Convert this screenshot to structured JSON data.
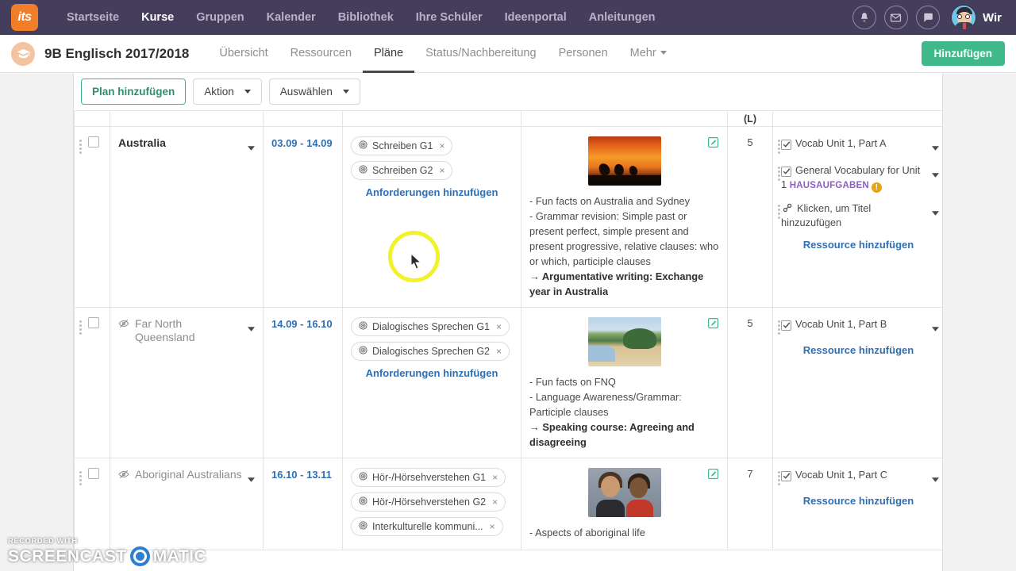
{
  "topnav": {
    "logo_text": "its",
    "links": [
      {
        "label": "Startseite",
        "active": false
      },
      {
        "label": "Kurse",
        "active": true
      },
      {
        "label": "Gruppen",
        "active": false
      },
      {
        "label": "Kalender",
        "active": false
      },
      {
        "label": "Bibliothek",
        "active": false
      },
      {
        "label": "Ihre Schüler",
        "active": false
      },
      {
        "label": "Ideenportal",
        "active": false
      },
      {
        "label": "Anleitungen",
        "active": false
      }
    ],
    "icons": [
      "bell-icon",
      "mail-icon",
      "chat-icon"
    ],
    "user_name": "Wir"
  },
  "coursebar": {
    "title": "9B Englisch 2017/2018",
    "tabs": [
      {
        "label": "Übersicht",
        "active": false
      },
      {
        "label": "Ressourcen",
        "active": false
      },
      {
        "label": "Pläne",
        "active": true
      },
      {
        "label": "Status/Nachbereitung",
        "active": false
      },
      {
        "label": "Personen",
        "active": false
      },
      {
        "label": "Mehr",
        "active": false,
        "has_caret": true
      }
    ],
    "add_button": "Hinzufügen"
  },
  "toolbar": {
    "add_plan_label": "Plan hinzufügen",
    "action_label": "Aktion",
    "select_label": "Auswählen"
  },
  "table": {
    "headers": {
      "lessons": "(L)"
    },
    "add_requirement_label": "Anforderungen hinzufügen",
    "add_resource_label": "Ressource hinzufügen",
    "rows": [
      {
        "title": "Australia",
        "hidden": false,
        "date": "03.09 - 14.09",
        "requirements": [
          {
            "label": "Schreiben G1"
          },
          {
            "label": "Schreiben G2"
          }
        ],
        "thumb": "kangaroo-sunset",
        "description_lines": [
          "- Fun facts on Australia and Sydney",
          "- Grammar revision: Simple past or present perfect, simple present and present progressive, relative clauses: who or which, participle clauses"
        ],
        "description_bold": "→ Argumentative writing: Exchange year in Australia",
        "lessons": "5",
        "resources": [
          {
            "label": "Vocab Unit 1, Part A",
            "icon": "checkbox-icon",
            "badge": "",
            "warn": false
          },
          {
            "label": "General Vocabulary for Unit 1",
            "icon": "checkbox-icon",
            "badge": "HAUSAUFGABEN",
            "warn": true
          },
          {
            "label": "Klicken, um Titel hinzuzufügen",
            "icon": "link-icon",
            "badge": "",
            "warn": false
          }
        ]
      },
      {
        "title": "Far North Queensland",
        "hidden": true,
        "date": "14.09 - 16.10",
        "requirements": [
          {
            "label": "Dialogisches Sprechen G1"
          },
          {
            "label": "Dialogisches Sprechen G2"
          }
        ],
        "thumb": "tropical-beach",
        "description_lines": [
          "- Fun facts on FNQ",
          "- Language Awareness/Grammar: Participle clauses"
        ],
        "description_bold": "→ Speaking course: Agreeing and disagreeing",
        "lessons": "5",
        "resources": [
          {
            "label": "Vocab Unit 1, Part B",
            "icon": "checkbox-icon",
            "badge": "",
            "warn": false
          }
        ]
      },
      {
        "title": "Aboriginal Australians",
        "hidden": true,
        "date": "16.10 - 13.11",
        "requirements": [
          {
            "label": "Hör-/Hörsehverstehen G1"
          },
          {
            "label": "Hör-/Hörsehverstehen G2"
          },
          {
            "label": "Interkulturelle kommuni..."
          }
        ],
        "thumb": "two-people",
        "description_lines": [
          "- Aspects of aboriginal life"
        ],
        "description_bold": "",
        "lessons": "7",
        "resources": [
          {
            "label": "Vocab Unit 1, Part C",
            "icon": "checkbox-icon",
            "badge": "",
            "warn": false
          }
        ]
      }
    ]
  },
  "watermark": {
    "top": "RECORDED WITH",
    "left": "SCREENCAST",
    "right": "MATIC"
  },
  "colors": {
    "nav_bg": "#453d5c",
    "accent_green": "#3fb98a",
    "link_blue": "#2f6fb5",
    "badge_purple": "#8b5fbf",
    "warn_orange": "#e8a317",
    "cursor_ring": "#f2f227"
  }
}
